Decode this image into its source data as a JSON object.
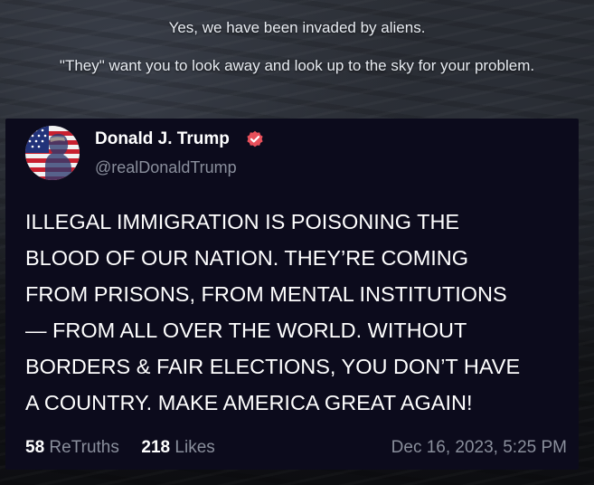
{
  "caption": {
    "line1": "Yes, we have been invaded by aliens.",
    "line2": "\"They\" want you to look away and look up to the sky for your problem."
  },
  "post": {
    "author": {
      "name": "Donald J. Trump",
      "handle": "@realDonaldTrump",
      "verified": true,
      "avatar_icon": "flag-portrait-avatar"
    },
    "body_lines": [
      "ILLEGAL  IMMIGRATION IS POISONING THE",
      "BLOOD OF OUR NATION. THEY’RE COMING",
      "FROM PRISONS, FROM MENTAL INSTITUTIONS",
      "— FROM ALL OVER THE WORLD. WITHOUT",
      "BORDERS & FAIR ELECTIONS, YOU DON’T HAVE",
      "A COUNTRY. MAKE AMERICA GREAT AGAIN!"
    ],
    "stats": {
      "retruths_count": "58",
      "retruths_label": "ReTruths",
      "likes_count": "218",
      "likes_label": "Likes"
    },
    "date": "Dec 16, 2023, 5:25 PM"
  },
  "colors": {
    "card_background": "#0c0b1c",
    "verified_badge": "#e8505b",
    "muted_text": "#8a8f9c",
    "caption_text": "#e8ecf2"
  }
}
